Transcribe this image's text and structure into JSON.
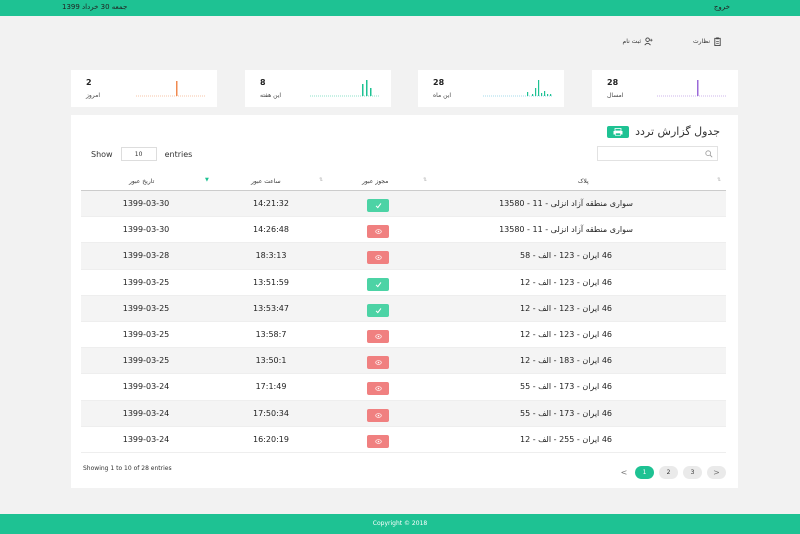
{
  "topbar": {
    "date": "جمعه 30 خرداد 1399",
    "logout": "خروج"
  },
  "actions": [
    {
      "label": "نظارت",
      "icon": "clipboard-icon"
    },
    {
      "label": "ثبت نام",
      "icon": "user-add-icon"
    }
  ],
  "cards": [
    {
      "value": "2",
      "label": "امروز",
      "color": "#f08a50"
    },
    {
      "value": "8",
      "label": "این هفته",
      "color": "#1ec293"
    },
    {
      "value": "28",
      "label": "این ماه",
      "color": "#4bb8d8"
    },
    {
      "value": "28",
      "label": "امسال",
      "color": "#9b6ad8"
    }
  ],
  "panel": {
    "title": "جدول گزارش تردد"
  },
  "table_controls": {
    "show": "Show",
    "entries_value": "10",
    "entries": "entries"
  },
  "table": {
    "headers": {
      "date": "تاریخ عبور",
      "time": "ساعت عبور",
      "permit": "مجوز عبور",
      "plate": "پلاک"
    },
    "rows": [
      {
        "date": "1399-03-30",
        "time": "14:21:32",
        "permit": "ok",
        "plate": "سواری منطقه آزاد انزلی - 11 - 13580"
      },
      {
        "date": "1399-03-30",
        "time": "14:26:48",
        "permit": "no",
        "plate": "سواری منطقه آزاد انزلی - 11 - 13580"
      },
      {
        "date": "1399-03-28",
        "time": "18:3:13",
        "permit": "no",
        "plate": "46 ایران - 123 - الف - 58"
      },
      {
        "date": "1399-03-25",
        "time": "13:51:59",
        "permit": "ok",
        "plate": "46 ایران - 123 - الف - 12"
      },
      {
        "date": "1399-03-25",
        "time": "13:53:47",
        "permit": "ok",
        "plate": "46 ایران - 123 - الف - 12"
      },
      {
        "date": "1399-03-25",
        "time": "13:58:7",
        "permit": "no",
        "plate": "46 ایران - 123 - الف - 12"
      },
      {
        "date": "1399-03-25",
        "time": "13:50:1",
        "permit": "no",
        "plate": "46 ایران - 183 - الف - 12"
      },
      {
        "date": "1399-03-24",
        "time": "17:1:49",
        "permit": "no",
        "plate": "46 ایران - 173 - الف - 55"
      },
      {
        "date": "1399-03-24",
        "time": "17:50:34",
        "permit": "no",
        "plate": "46 ایران - 173 - الف - 55"
      },
      {
        "date": "1399-03-24",
        "time": "16:20:19",
        "permit": "no",
        "plate": "46 ایران - 255 - الف - 12"
      }
    ]
  },
  "info": "Showing 1 to 10 of 28 entries",
  "pagination": {
    "prev": "<",
    "pages": [
      "1",
      "2",
      "3"
    ],
    "next": ">",
    "active": "1"
  },
  "footer": "Copyright © 2018"
}
